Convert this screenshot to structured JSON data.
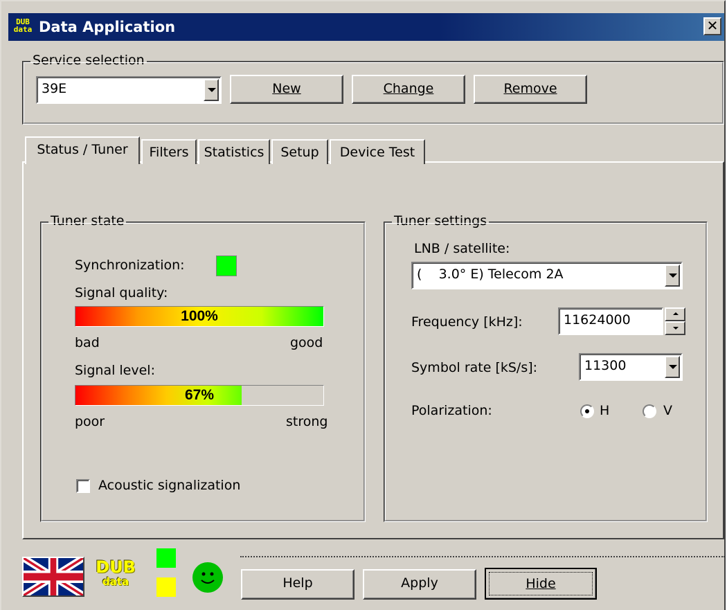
{
  "window": {
    "title": "Data Application",
    "close_glyph": "✕"
  },
  "service_selection": {
    "group_label": "Service selection",
    "selected_service": "39E",
    "new_label": "New",
    "change_label": "Change",
    "remove_label": "Remove"
  },
  "tabs": [
    {
      "label": "Status / Tuner",
      "active": true
    },
    {
      "label": "Filters",
      "active": false
    },
    {
      "label": "Statistics",
      "active": false
    },
    {
      "label": "Setup",
      "active": false
    },
    {
      "label": "Device Test",
      "active": false
    }
  ],
  "tuner_state": {
    "group_label": "Tuner state",
    "sync_label": "Synchronization:",
    "sync_color": "#00ff00",
    "signal_quality_label": "Signal quality:",
    "signal_quality_text": "100%",
    "signal_quality_fraction": 1.0,
    "quality_low_label": "bad",
    "quality_high_label": "good",
    "signal_level_label": "Signal level:",
    "signal_level_text": "67%",
    "signal_level_fraction": 0.67,
    "level_low_label": "poor",
    "level_high_label": "strong",
    "acoustic_label": "Acoustic signalization",
    "acoustic_checked": false
  },
  "tuner_settings": {
    "group_label": "Tuner settings",
    "lnb_label": "LNB / satellite:",
    "lnb_value": "(    3.0° E) Telecom 2A",
    "frequency_label": "Frequency [kHz]:",
    "frequency_value": "11624000",
    "symbol_rate_label": "Symbol rate [kS/s]:",
    "symbol_rate_value": "11300",
    "polarization_label": "Polarization:",
    "polarization_h": "H",
    "polarization_v": "V",
    "polarization_selected": "H"
  },
  "footer": {
    "logo_text_top": "DUB",
    "logo_text_bottom": "data",
    "indicator_top_color": "#00ff00",
    "indicator_bottom_color": "#ffff00",
    "help_label": "Help",
    "apply_label": "Apply",
    "hide_label": "Hide"
  },
  "colors": {
    "titlebar": "#0a246a",
    "face": "#d4d0c8"
  }
}
